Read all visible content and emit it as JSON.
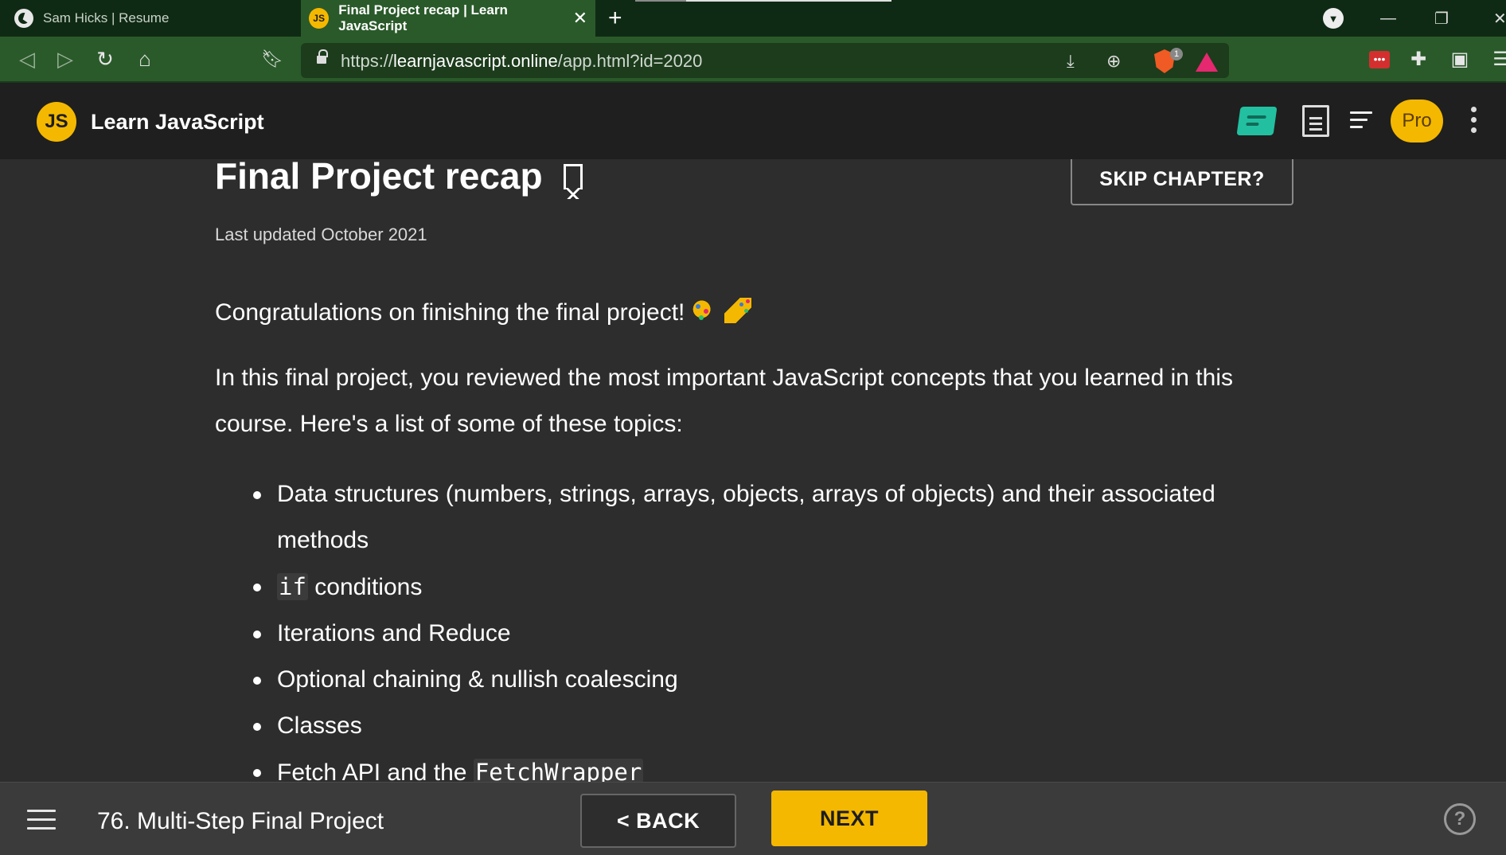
{
  "browser": {
    "tabs": [
      {
        "title": "Sam Hicks | Resume",
        "active": false
      },
      {
        "title": "Final Project recap | Learn JavaScript",
        "active": true
      }
    ],
    "url_prefix": "https://",
    "url_domain": "learnjavascript.online",
    "url_path": "/app.html?id=2020",
    "brave_count": "1",
    "icons": [
      "globe-icon",
      "js-favicon",
      "close-icon",
      "plus-icon",
      "back-icon",
      "forward-icon",
      "reload-icon",
      "home-icon",
      "bookmark-icon",
      "lock-icon",
      "download-icon",
      "zoom-icon",
      "brave-shield-icon",
      "bat-icon",
      "extension-icon",
      "puzzle-icon",
      "wallet-icon",
      "menu-icon"
    ]
  },
  "app": {
    "logo_text": "JS",
    "title": "Learn JavaScript",
    "pro_label": "Pro",
    "accent_color": "#f5b800"
  },
  "page": {
    "title": "Final Project recap",
    "skip_label": "SKIP CHAPTER?",
    "last_updated": "Last updated October 2021",
    "intro": "Congratulations on finishing the final project!",
    "body_line1": "In this final project, you reviewed the most important JavaScript concepts that you learned in this",
    "body_line2": "course. Here's a list of some of these topics:",
    "topics": {
      "t1": "Data structures (numbers, strings, arrays, objects, arrays of objects) and their associated",
      "t1b": "methods",
      "t2_code": "if",
      "t2_text": " conditions",
      "t3": "Iterations and Reduce",
      "t4": "Optional chaining & nullish coalescing",
      "t5": "Classes",
      "t6_text": "Fetch API and the ",
      "t6_code": "FetchWrapper"
    }
  },
  "footer": {
    "chapter": "76. Multi-Step Final Project",
    "back_label": "< BACK",
    "next_label": "NEXT"
  }
}
